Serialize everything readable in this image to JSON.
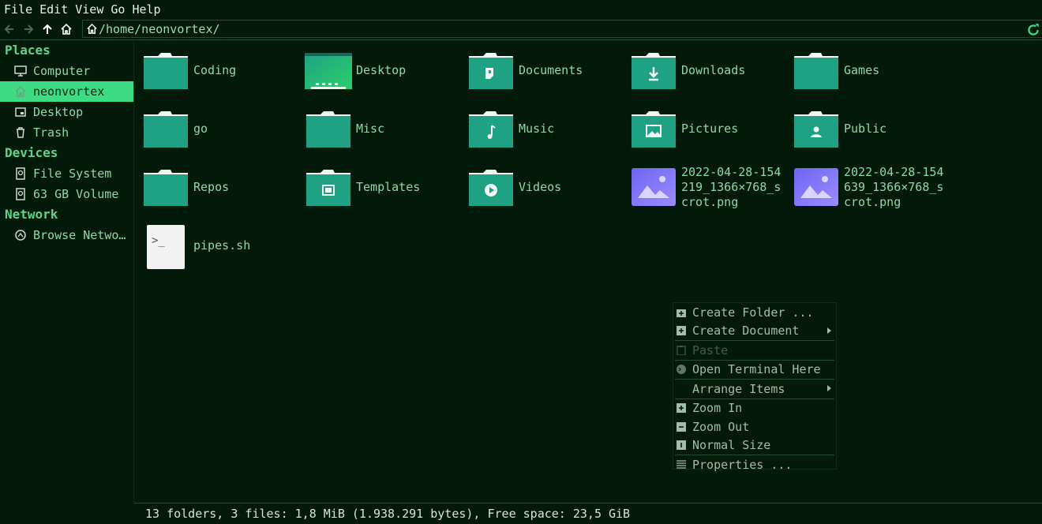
{
  "menubar": [
    "File",
    "Edit",
    "View",
    "Go",
    "Help"
  ],
  "toolbar": {
    "path": "/home/neonvortex/"
  },
  "sidebar": {
    "places_head": "Places",
    "places": [
      {
        "label": "Computer",
        "icon": "monitor-icon"
      },
      {
        "label": "neonvortex",
        "icon": "home-icon",
        "active": true
      },
      {
        "label": "Desktop",
        "icon": "desktop-icon"
      },
      {
        "label": "Trash",
        "icon": "trash-icon"
      }
    ],
    "devices_head": "Devices",
    "devices": [
      {
        "label": "File System",
        "icon": "drive-icon"
      },
      {
        "label": "63 GB Volume",
        "icon": "drive-icon"
      }
    ],
    "network_head": "Network",
    "network": [
      {
        "label": "Browse Netwo…",
        "icon": "network-icon"
      }
    ]
  },
  "items": [
    {
      "label": "Coding",
      "kind": "folder"
    },
    {
      "label": "Desktop",
      "kind": "desktop"
    },
    {
      "label": "Documents",
      "kind": "folder-doc"
    },
    {
      "label": "Downloads",
      "kind": "folder-down"
    },
    {
      "label": "Games",
      "kind": "folder"
    },
    {
      "label": "go",
      "kind": "folder"
    },
    {
      "label": "Misc",
      "kind": "folder"
    },
    {
      "label": "Music",
      "kind": "folder-music"
    },
    {
      "label": "Pictures",
      "kind": "folder-pic"
    },
    {
      "label": "Public",
      "kind": "folder-user"
    },
    {
      "label": "Repos",
      "kind": "folder"
    },
    {
      "label": "Templates",
      "kind": "folder-tpl"
    },
    {
      "label": "Videos",
      "kind": "folder-video"
    },
    {
      "label": "2022-04-28-154219_1366×768_scrot.png",
      "kind": "image"
    },
    {
      "label": "2022-04-28-154639_1366×768_scrot.png",
      "kind": "image"
    },
    {
      "label": "pipes.sh",
      "kind": "script"
    }
  ],
  "statusbar": "13 folders, 3 files: 1,8 MiB (1.938.291 bytes), Free space: 23,5 GiB",
  "context_menu": {
    "create_folder": "Create Folder ...",
    "create_document": "Create Document",
    "paste": "Paste",
    "open_terminal": "Open Terminal Here",
    "arrange_items": "Arrange Items",
    "zoom_in": "Zoom In",
    "zoom_out": "Zoom Out",
    "normal_size": "Normal Size",
    "properties": "Properties ..."
  },
  "colors": {
    "accent": "#3ddc84",
    "folder": "#1fa184",
    "background": "#031a0b"
  }
}
